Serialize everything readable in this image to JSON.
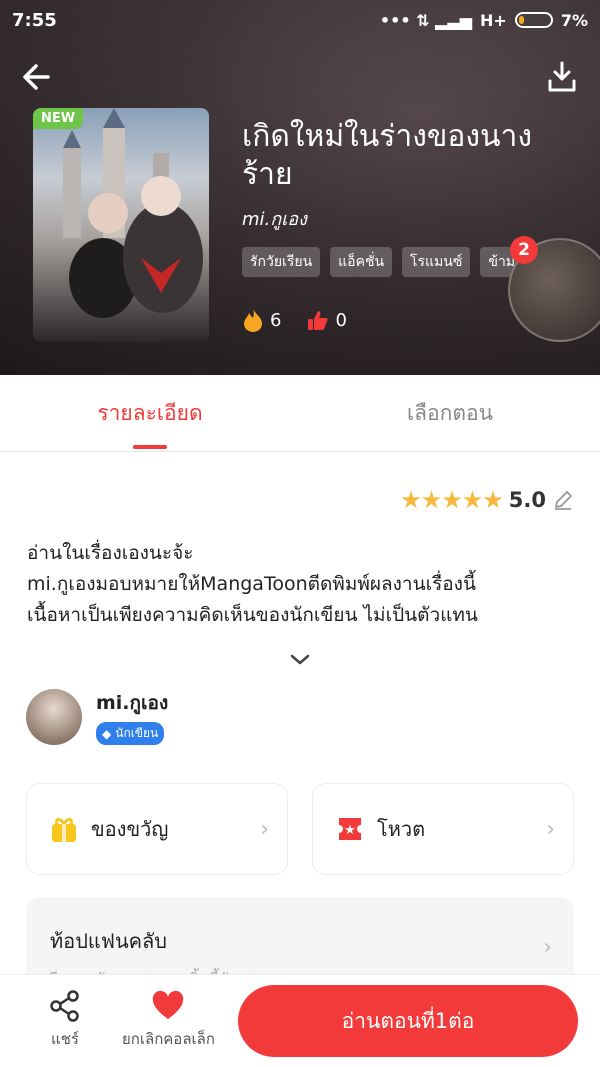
{
  "status_bar": {
    "time": "7:55",
    "network": "H+",
    "battery": "7%"
  },
  "header": {
    "badge_new": "NEW",
    "title": "เกิดใหม่ในร่างของนางร้าย",
    "author": "mi.กูเอง",
    "tags": [
      "รักวัยเรียน",
      "แอ็คชั่น",
      "โรแมนซ์",
      "ข้าม"
    ],
    "likes_fire": "6",
    "likes_thumb": "0",
    "float_badge_count": "2"
  },
  "tabs": [
    {
      "label": "รายละเอียด",
      "active": true
    },
    {
      "label": "เลือกตอน",
      "active": false
    }
  ],
  "rating": {
    "value": "5.0",
    "stars": 5
  },
  "description": [
    "อ่านในเรื่องเองนะจ้ะ",
    "mi.กูเองมอบหมายให้MangaToonตีดพิมพ์ผลงานเรื่องนี้",
    "เนื้อหาเป็นเพียงความคิดเห็นของนักเขียน ไม่เป็นตัวแทน"
  ],
  "writer": {
    "name": "mi.กูเอง",
    "badge": "นักเขียน"
  },
  "cards": {
    "gift": "ของขวัญ",
    "vote": "โหวต"
  },
  "fanclub": {
    "title": "ท้อปแฟนคลับ",
    "subtitle": "รีบมาสนับสนุนผลงานชิ้นนี้กันเถอะ"
  },
  "bottom": {
    "share": "แชร์",
    "uncollect": "ยกเลิกคอลเล็ก",
    "read": "อ่านตอนที่1ต่อ"
  },
  "colors": {
    "accent": "#f23a3a",
    "star": "#f6b93b",
    "new_badge": "#6ec54a",
    "writer_badge": "#2f80ed"
  }
}
